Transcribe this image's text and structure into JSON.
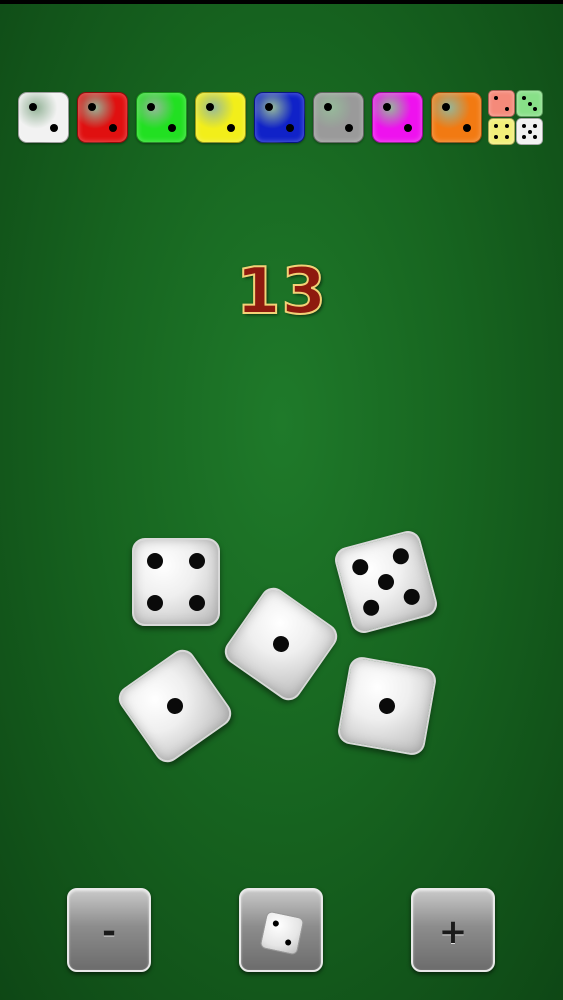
{
  "palette": {
    "colors": [
      {
        "name": "white",
        "hex": "#f2f2f2"
      },
      {
        "name": "red",
        "hex": "#e01010"
      },
      {
        "name": "green",
        "hex": "#22e022"
      },
      {
        "name": "yellow",
        "hex": "#f2ee1a"
      },
      {
        "name": "blue",
        "hex": "#1022c8"
      },
      {
        "name": "gray",
        "hex": "#9a9a9a"
      },
      {
        "name": "magenta",
        "hex": "#ee12ee"
      },
      {
        "name": "orange",
        "hex": "#f27a12"
      }
    ],
    "mixed": [
      "#f58a7a",
      "#88e088",
      "#f2f07a",
      "#f2f2f2"
    ]
  },
  "total": "13",
  "dice": [
    {
      "value": 4,
      "rotation": 0
    },
    {
      "value": 5,
      "rotation": -15
    },
    {
      "value": 1,
      "rotation": 35
    },
    {
      "value": 1,
      "rotation": -35
    },
    {
      "value": 1,
      "rotation": 10
    }
  ],
  "buttons": {
    "remove_label": "-",
    "roll_icon": "die-icon",
    "add_label": "+"
  }
}
